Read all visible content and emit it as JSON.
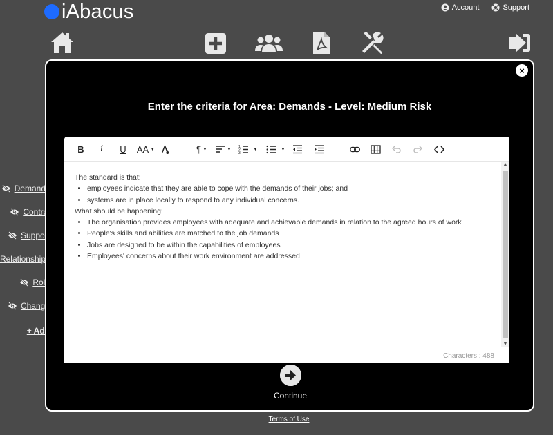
{
  "app": {
    "logo_text": "iAbacus"
  },
  "header": {
    "account_label": "Account",
    "support_label": "Support"
  },
  "sidebar": {
    "items": [
      {
        "label": "Demands"
      },
      {
        "label": "Control"
      },
      {
        "label": "Support"
      },
      {
        "label": "Relationships"
      },
      {
        "label": "Role"
      },
      {
        "label": "Change"
      }
    ],
    "add_label": "+ Add"
  },
  "footer": {
    "terms_label": "Terms of Use"
  },
  "modal": {
    "title": "Enter the criteria for Area: Demands - Level: Medium Risk",
    "close_label": "×",
    "continue_label": "Continue"
  },
  "toolbar": {
    "bold": "B",
    "italic": "i",
    "underline": "U",
    "font_size": "AA",
    "paragraph": "¶"
  },
  "editor": {
    "intro": "The standard is that:",
    "list1": [
      "employees indicate that they are able to cope with the demands of their jobs; and",
      "systems are in place locally to respond to any individual concerns."
    ],
    "heading2": "What should be happening:",
    "list2": [
      "The organisation provides employees with adequate and achievable demands in relation to the agreed hours of work",
      "People's skills and abilities are matched to the job demands",
      "Jobs are designed to be within the capabilities of employees",
      "Employees' concerns about their work environment are addressed"
    ],
    "char_count": "Characters : 488"
  },
  "icons": {
    "home": "home-icon",
    "add": "add-icon",
    "users": "users-icon",
    "pdf": "pdf-icon",
    "tools": "tools-icon",
    "logout": "logout-icon",
    "visibility_off": "eye-slash-icon"
  },
  "colors": {
    "logo_dot": "#1e6bff",
    "background": "#4a4a4a",
    "modal": "#000000"
  }
}
